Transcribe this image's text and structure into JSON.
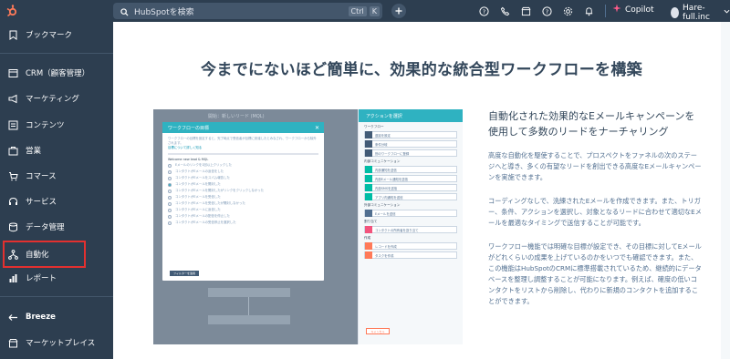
{
  "topbar": {
    "search_placeholder": "HubSpotを検索",
    "kbd_ctrl": "Ctrl",
    "kbd_k": "K",
    "copilot_label": "Copilot",
    "account_name": "Hare-full.inc",
    "accent_color": "#ff7a59"
  },
  "sidebar": {
    "items": [
      {
        "label": "ブックマーク",
        "icon": "bookmark-icon"
      },
      {
        "label": "CRM（顧客管理）",
        "icon": "crm-icon"
      },
      {
        "label": "マーケティング",
        "icon": "megaphone-icon"
      },
      {
        "label": "コンテンツ",
        "icon": "content-icon"
      },
      {
        "label": "営業",
        "icon": "sales-icon"
      },
      {
        "label": "コマース",
        "icon": "commerce-icon"
      },
      {
        "label": "サービス",
        "icon": "service-icon"
      },
      {
        "label": "データ管理",
        "icon": "data-icon"
      },
      {
        "label": "自動化",
        "icon": "automation-icon"
      },
      {
        "label": "レポート",
        "icon": "report-icon"
      },
      {
        "label": "Breeze",
        "icon": "breeze-icon"
      },
      {
        "label": "マーケットプレイス",
        "icon": "marketplace-icon"
      }
    ],
    "active_item": "自動化"
  },
  "main": {
    "headline": "今までにないほど簡単に、効果的な統合型ワークフローを構築",
    "copy_title": "自動化された効果的なEメールキャンペーンを使用して多数のリードをナーチャリング",
    "paragraphs": [
      "高度な自動化を駆使することで、プロスペクトをファネルの次のステージへと導き、多くの有望なリードを創出できる高度なEメールキャンペーンを実施できます。",
      "コーディングなしで、洗練されたEメールを作成できます。また、トリガー、条件、アクションを選択し、対象となるリードに合わせて適切なEメールを最適なタイミングで送信することが可能です。",
      "ワークフロー機能では明確な目標が設定でき、その目標に対してEメールがどれくらいの成果を上げているのかをいつでも確認できます。また、この機能はHubSpotのCRMに標準搭載されているため、継続的にデータベースを整理し調整することが可能になります。例えば、確度の低いコンタクトをリストから削除し、代わりに新規のコンタクトを追加することができます。"
    ]
  },
  "preview": {
    "canvas_title": "開始：新しいリード (MQL)",
    "dialog_title": "ワークフローの目標",
    "dialog_intro": "ワークフローの目標を設定すると、完了時点で受信者が目標に到達したとみなされ、ワークフローから除外されます。",
    "dialog_link": "目標について詳しく知る",
    "dialog_section": "Welcome new lead & MQL",
    "dialog_options": [
      "Eメールのリンクを1回以上クリックした",
      "コンタクトがEメールの返信をした",
      "コンタクトがEメールをスパム報告した",
      "コンタクトがEメールを開封した",
      "コンタクトがEメールを開封したがリンクをクリックしなかった",
      "コンタクトがEメールを受信した",
      "コンタクトがEメールを受信したが開封しなかった",
      "コンタクトがEメールに返信した",
      "コンタクトがEメールの配信を停止した",
      "コンタクトがEメールの受信停止を選択した"
    ],
    "dialog_button": "フィルターを適用",
    "action_panel_title": "アクションを選択",
    "action_sections": [
      {
        "title": "ワークフロー",
        "rows": [
          "遅延を設定",
          "条件分岐",
          "別のワークフローに登録"
        ]
      },
      {
        "title": "内部コミュニケーション",
        "rows": [
          "内部通知を送信",
          "内部Eメール通知を送信",
          "内部SMSを送信",
          "アプリ内通知を送信"
        ]
      },
      {
        "title": "外部コミュニケーション",
        "rows": [
          "Eメールを送信"
        ]
      },
      {
        "title": "割り当て",
        "rows": [
          "コンタクトの所有者を割り当て"
        ]
      },
      {
        "title": "作成",
        "rows": [
          "レコードを作成",
          "タスクを作成"
        ]
      }
    ],
    "action_button": "キャンセル"
  }
}
